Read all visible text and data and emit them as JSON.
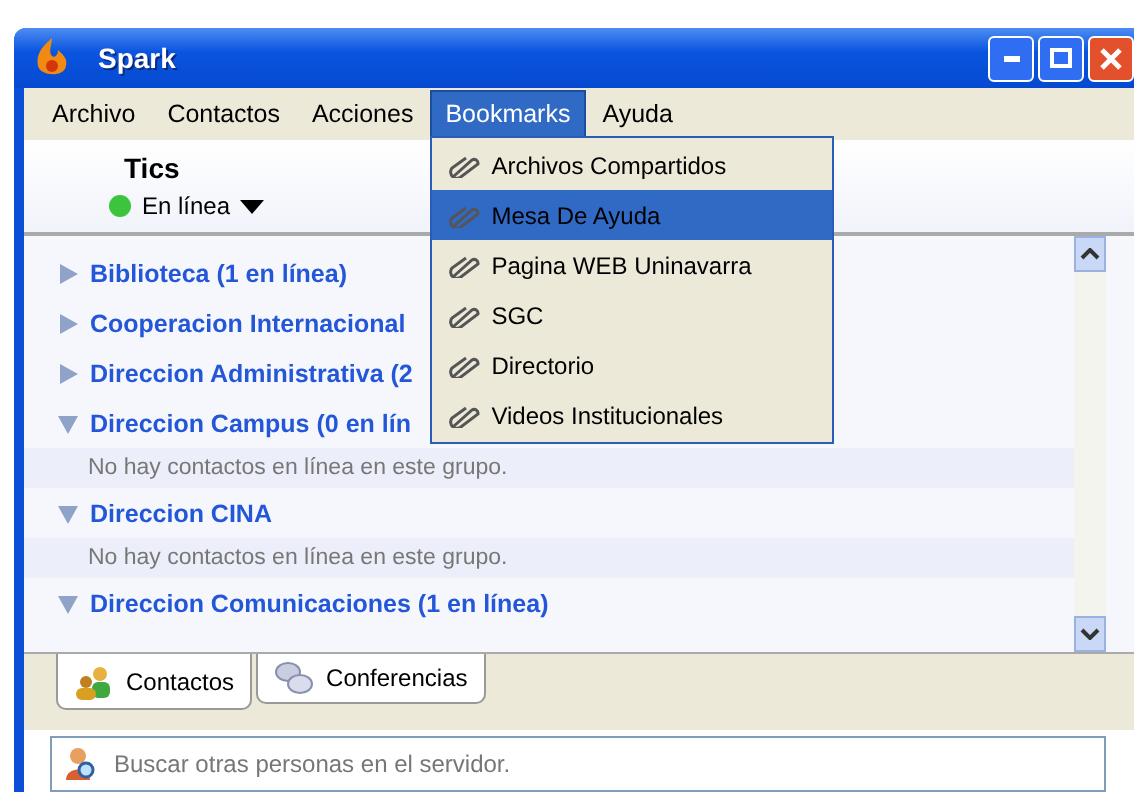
{
  "window": {
    "title": "Spark"
  },
  "menu": [
    {
      "label": "Archivo",
      "selected": false
    },
    {
      "label": "Contactos",
      "selected": false
    },
    {
      "label": "Acciones",
      "selected": false
    },
    {
      "label": "Bookmarks",
      "selected": true
    },
    {
      "label": "Ayuda",
      "selected": false
    }
  ],
  "bookmarks_menu": [
    {
      "label": "Archivos Compartidos",
      "selected": false
    },
    {
      "label": "Mesa De Ayuda",
      "selected": true
    },
    {
      "label": "Pagina WEB Uninavarra",
      "selected": false
    },
    {
      "label": "SGC",
      "selected": false
    },
    {
      "label": "Directorio",
      "selected": false
    },
    {
      "label": "Videos Institucionales",
      "selected": false
    }
  ],
  "user": {
    "name": "Tics",
    "status": "En línea"
  },
  "groups": [
    {
      "name": "Biblioteca (1 en línea)",
      "expanded": false
    },
    {
      "name": "Cooperacion Internacional",
      "expanded": false
    },
    {
      "name": "Direccion Administrativa (2",
      "expanded": false
    },
    {
      "name": "Direccion Campus (0 en lín",
      "expanded": true,
      "empty_note": "No hay contactos en línea en este grupo."
    },
    {
      "name": "Direccion CINA",
      "expanded": true,
      "empty_note": "No hay contactos en línea en este grupo."
    },
    {
      "name": "Direccion Comunicaciones (1 en línea)",
      "expanded": true
    }
  ],
  "tabs": [
    {
      "label": "Contactos",
      "selected": true
    },
    {
      "label": "Conferencias",
      "selected": false
    }
  ],
  "search": {
    "placeholder": "Buscar otras personas en el servidor."
  }
}
